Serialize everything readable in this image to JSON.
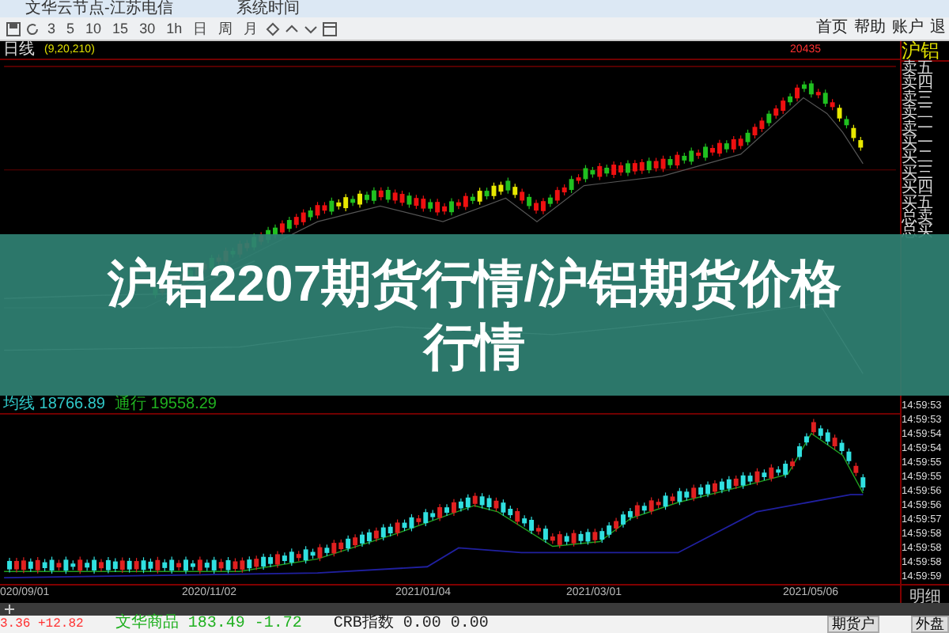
{
  "top_bar": {
    "items": [
      "文华云节点-江苏电信",
      "系统时间"
    ]
  },
  "toolbar": {
    "periods": [
      "3",
      "5",
      "10",
      "15",
      "30",
      "1h",
      "日",
      "周",
      "月"
    ],
    "links": [
      "首页",
      "帮助",
      "账户",
      "退"
    ]
  },
  "chart": {
    "period_label": "日线",
    "params": "(9,20,210)",
    "peak_label": "20435",
    "legend": [
      {
        "text": "均线 18766.89",
        "color": "#30c8c8"
      },
      {
        "text": "通行 19558.29",
        "color": "#20b020"
      }
    ],
    "dates": [
      "020/09/01",
      "2020/11/02",
      "2021/01/04",
      "2021/03/01",
      "2021/05/06"
    ]
  },
  "quote_panel": {
    "title": "沪铝",
    "levels": [
      "卖五",
      "卖四",
      "卖三",
      "卖二",
      "卖一",
      "买一",
      "买二",
      "买三",
      "买四",
      "买五"
    ],
    "totals": [
      "总卖",
      "总买"
    ],
    "times": [
      "14:59:53",
      "14:59:53",
      "14:59:54",
      "14:59:54",
      "14:59:55",
      "14:59:55",
      "14:59:56",
      "14:59:56",
      "14:59:57",
      "14:59:58",
      "14:59:58",
      "14:59:58",
      "14:59:59"
    ],
    "tab": "明细"
  },
  "banner": {
    "title": "沪铝2207期货行情/沪铝期货价格行情"
  },
  "status_bar": {
    "indices": [
      {
        "text": "3.36 +12.82",
        "color": "#ff3030"
      },
      {
        "text": "文华商品 183.49 -1.72",
        "color": "#20b020"
      },
      {
        "text": "CRB指数 0.00 0.00",
        "color": "#202020"
      }
    ],
    "buttons": [
      "期货户",
      "外盘"
    ]
  }
}
